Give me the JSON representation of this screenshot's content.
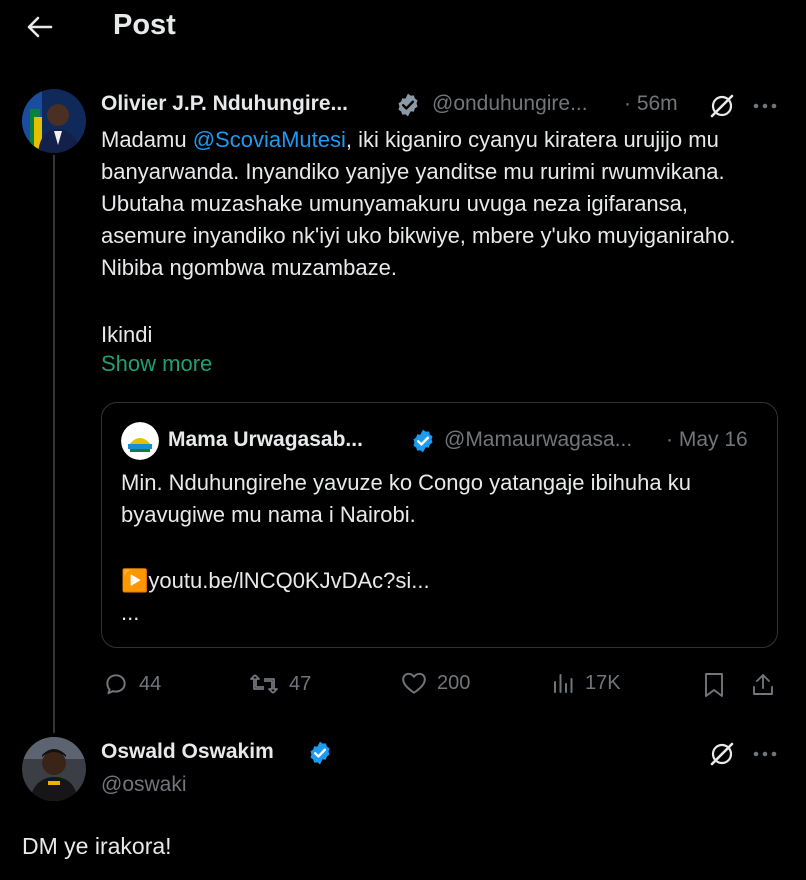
{
  "header": {
    "title": "Post"
  },
  "tweet": {
    "author_name": "Olivier J.P. Nduhungire...",
    "author_handle": "@onduhungire...",
    "time": "· 56m",
    "text_before_mention": "Madamu ",
    "mention": "@ScoviaMutesi",
    "text_after_mention": ", iki kiganiro cyanyu kiratera urujijo mu banyarwanda. Inyandiko yanjye yanditse mu rurimi rwumvikana. Ubutaha muzashake umunyamakuru uvuga neza igifaransa, asemure inyandiko nk'iyi uko bikwiye, mbere y'uko muyiganiraho. Nibiba ngombwa muzambaze.",
    "text_second_paragraph": "Ikindi",
    "show_more": "Show more",
    "quote": {
      "author_name": "Mama Urwagasab...",
      "author_handle": "@Mamaurwagasa...",
      "time": "· May 16",
      "text": "Min. Nduhungirehe yavuze ko Congo yatangaje ibihuha ku byavugiwe mu nama i Nairobi.",
      "link_prefix": "▶️",
      "link": "youtu.be/lNCQ0KJvDAc?si...",
      "ellipsis": "..."
    },
    "stats": {
      "replies": "44",
      "reposts": "47",
      "likes": "200",
      "views": "17K"
    }
  },
  "reply": {
    "author_name": "Oswald Oswakim",
    "author_handle": "@oswaki",
    "text": "DM ye irakora!"
  },
  "colors": {
    "accent": "#1d9bf0",
    "link": "#1f9f72",
    "muted": "#71767b",
    "border": "#2f3336"
  },
  "icons": [
    "back-arrow-icon",
    "verified-badge-icon",
    "grok-icon",
    "more-icon",
    "reply-icon",
    "repost-icon",
    "like-icon",
    "views-icon",
    "bookmark-icon",
    "share-icon"
  ]
}
